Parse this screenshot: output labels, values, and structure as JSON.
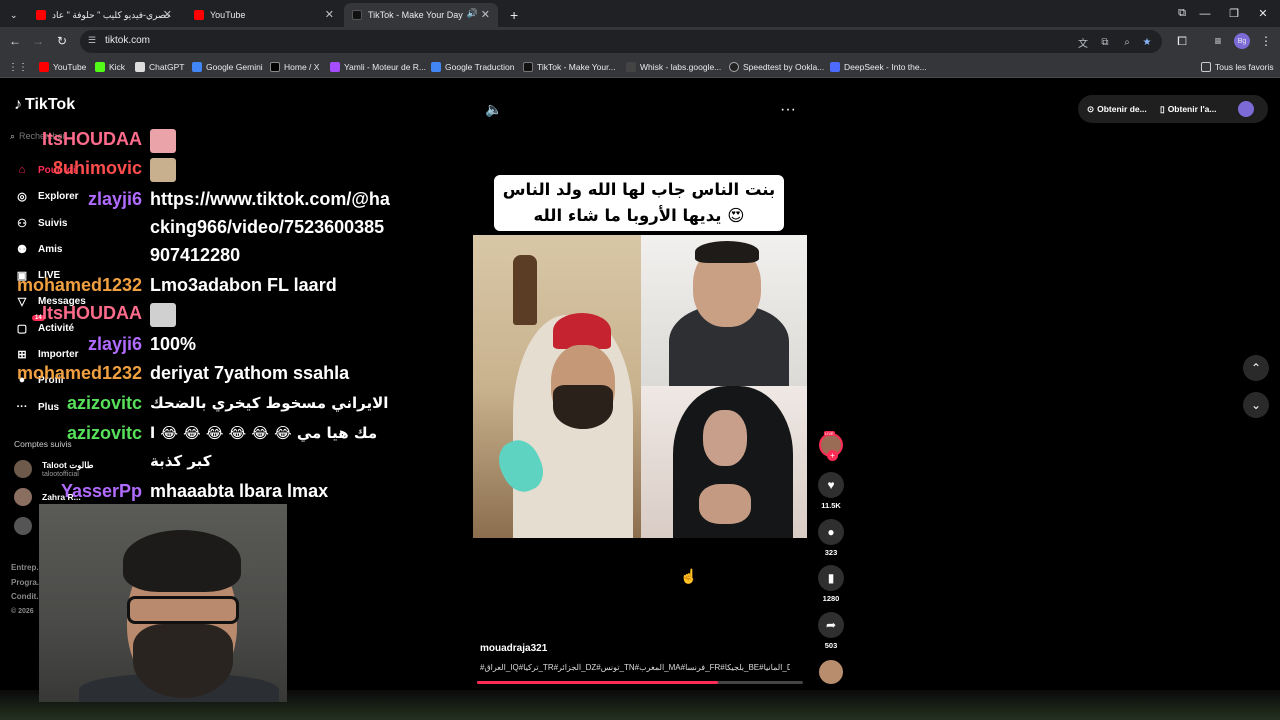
{
  "browser": {
    "tabs": [
      {
        "title": "حصري-فيديو كليب \" حلوفة \" عاد...",
        "active": false
      },
      {
        "title": "YouTube",
        "active": false
      },
      {
        "title": "TikTok - Make Your Day",
        "active": true
      }
    ],
    "new_tab": "+",
    "url": "tiktok.com",
    "bookmarks": [
      "YouTube",
      "Kick",
      "ChatGPT",
      "Google Gemini",
      "Home / X",
      "Yamli - Moteur de R...",
      "Google Traduction",
      "TikTok - Make Your...",
      "Whisk - labs.google...",
      "Speedtest by Ookla...",
      "DeepSeek - Into the..."
    ],
    "all_bookmarks": "Tous les favoris"
  },
  "tiktok": {
    "logo": "TikTok",
    "search_placeholder": "Rechercher",
    "nav": [
      {
        "label": "Pour toi",
        "icon": "home-icon"
      },
      {
        "label": "Explorer",
        "icon": "compass-icon"
      },
      {
        "label": "Suivis",
        "icon": "following-icon"
      },
      {
        "label": "Amis",
        "icon": "friends-icon"
      },
      {
        "label": "LIVE",
        "icon": "live-icon"
      },
      {
        "label": "Messages",
        "icon": "messages-icon"
      },
      {
        "label": "Activité",
        "icon": "activity-icon",
        "badge": "14"
      },
      {
        "label": "Importer",
        "icon": "upload-icon"
      },
      {
        "label": "Profil",
        "icon": "profile-icon"
      },
      {
        "label": "Plus",
        "icon": "more-icon"
      }
    ],
    "following_title": "Comptes suivis",
    "following": [
      {
        "name": "Taloot طالوت",
        "handle": "talootofficial"
      },
      {
        "name": "Zahra R...",
        "handle": ""
      }
    ],
    "footer": [
      "Entrep...",
      "Progra...",
      "Condit...",
      "© 2026"
    ],
    "top_right": {
      "btn1": "Obtenir de...",
      "btn2": "Obtenir l'a..."
    },
    "caption_line1": "بنت الناس جاب لها الله ولد الناس",
    "caption_line2": "يديها الأروبا ما شاء الله 😍",
    "actions": [
      {
        "icon": "heart-icon",
        "count": "11.5K"
      },
      {
        "icon": "comment-icon",
        "count": "323"
      },
      {
        "icon": "bookmark-icon",
        "count": "1280"
      },
      {
        "icon": "share-icon",
        "count": "503"
      }
    ],
    "live_label": "LIVE",
    "author": "mouadraja321",
    "hashtags": "#العراق_IQ#تركيا_TR#الجزائر_DZ#تونس_TN#المغرب_MA#فرنسا_FR#بلجيكا_BE#المانيا_DE#القفيه #الزواج",
    "progress": 0.74
  },
  "chat": [
    {
      "user": "ItsHOUDAA",
      "color": "#ff6b8a",
      "text": ""
    },
    {
      "user": "8uhimovic",
      "color": "#ff4d4d",
      "text": ""
    },
    {
      "user": "zlayji6",
      "color": "#b06bff",
      "text": "https://www.tiktok.com/@hacking966/video/7523600385907412280"
    },
    {
      "user": "mohamed1232",
      "color": "#f0a040",
      "text": "Lmo3adabon FL laard"
    },
    {
      "user": "ItsHOUDAA",
      "color": "#ff6b8a",
      "text": ""
    },
    {
      "user": "zlayji6",
      "color": "#b06bff",
      "text": "100%"
    },
    {
      "user": "mohamed1232",
      "color": "#f0a040",
      "text": "deriyat 7yathom ssahla"
    },
    {
      "user": "azizovitc",
      "color": "#57e05a",
      "text": "الايراني مسخوط كيخري بالضحك"
    },
    {
      "user": "azizovitc",
      "color": "#57e05a",
      "text": "مك هيا مي 😂 😂 😂 😂 😂 😂 اكبر كذبة"
    },
    {
      "user": "YasserPp",
      "color": "#b06bff",
      "text": "mhaaabta lbara lmax"
    }
  ],
  "colors": {
    "accent": "#fe2c55",
    "chrome_bg": "#202124",
    "toolbar_bg": "#35363a"
  }
}
